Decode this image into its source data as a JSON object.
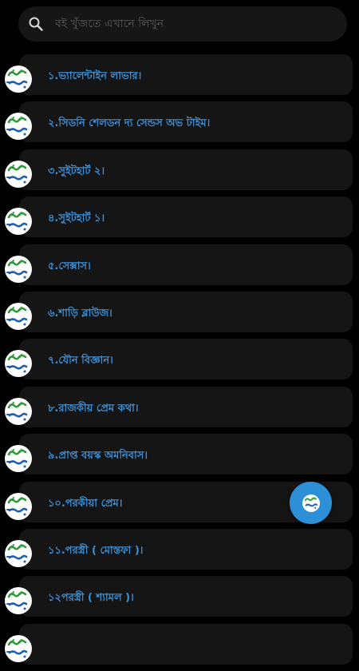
{
  "search": {
    "placeholder": "বই খুঁজতে এখানে লিখুন"
  },
  "books": [
    {
      "title": "১.ভ্যালেন্টাইন লাভার।"
    },
    {
      "title": "২.সিডনি শেলডন দ্য সেন্ডস অভ টাইম।"
    },
    {
      "title": "৩.সুইটহার্ট ২।"
    },
    {
      "title": "৪.সুইটহার্ট ১।"
    },
    {
      "title": "৫.সেক্সাস।"
    },
    {
      "title": "৬.শাড়ি ব্লাউজ।"
    },
    {
      "title": "৭.যৌন বিজ্ঞান।"
    },
    {
      "title": "৮.রাজকীয় প্রেম কথা।"
    },
    {
      "title": "৯.প্রাপ্ত বয়স্ক অমনিবাস।"
    },
    {
      "title": "১০.পরকীয়া প্রেম।"
    },
    {
      "title": "১১.পরস্ত্রী ( মোস্তফা )।"
    },
    {
      "title": "১২পরস্ত্রী ( শ্যামল )।"
    },
    {
      "title": ""
    }
  ],
  "icons": {
    "search": "search-icon",
    "avatar": "boi-tong-logo-icon",
    "fab": "boi-tong-logo-icon"
  },
  "colors": {
    "background": "#000000",
    "card": "#151515",
    "title": "#3d8fd6",
    "fab": "#2d8fd8",
    "logo_green": "#2e9a3a",
    "logo_blue": "#1f5fb0"
  }
}
